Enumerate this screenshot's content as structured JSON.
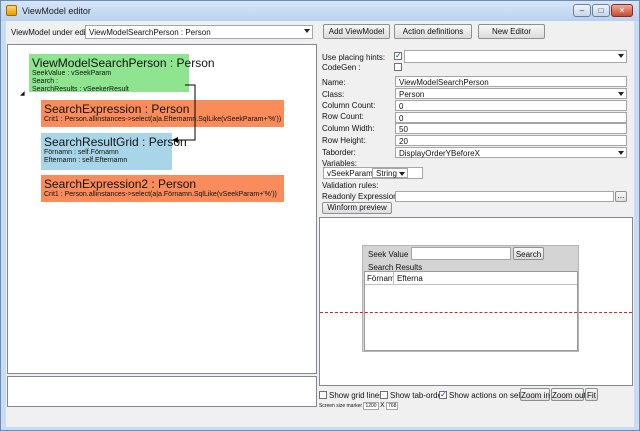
{
  "window": {
    "title": "ViewModel editor"
  },
  "toolbar": {
    "vm_label": "ViewModel under edit:",
    "vm_value": "ViewModelSearchPerson : Person",
    "add_viewmodel": "Add ViewModel",
    "action_definitions": "Action definitions",
    "new_editor": "New Editor"
  },
  "canvas": {
    "nodes": [
      {
        "title": "ViewModelSearchPerson : Person",
        "lines": [
          "SeekValue : vSeekParam",
          "Search :",
          "SearchResults : vSeekerResult"
        ]
      },
      {
        "title": "SearchExpression : Person",
        "lines": [
          "Crit1 : Person.allinstances->select(a|a.Efternamn.SqlLike(vSeekParam+'%'))"
        ]
      },
      {
        "title": "SearchResultGrid : Person",
        "lines": [
          "Förnamn : self.Förnamn",
          "Efternamn : self.Efternamn"
        ]
      },
      {
        "title": "SearchExpression2 : Person",
        "lines": [
          "Crit1 : Person.allinstances->select(a|a.Förnamn.SqlLike(vSeekParam+'%'))"
        ]
      }
    ]
  },
  "props": {
    "placing_hints_label": "Use placing hints:",
    "codegen_label": "CodeGen :",
    "name_label": "Name:",
    "name_value": "ViewModelSearchPerson",
    "class_label": "Class:",
    "class_value": "Person",
    "colcount_label": "Column Count:",
    "colcount_value": "0",
    "rowcount_label": "Row Count:",
    "rowcount_value": "0",
    "colwidth_label": "Column Width:",
    "colwidth_value": "50",
    "rowheight_label": "Row Height:",
    "rowheight_value": "20",
    "taborder_label": "Taborder:",
    "taborder_value": "DisplayOrderYBeforeX",
    "variables_label": "Variables:",
    "var_name": "vSeekParam",
    "var_type": "String",
    "validation_label": "Validation rules:",
    "readonly_label": "Readonly Expression:",
    "readonly_btn": "...",
    "winform_preview": "Winform preview"
  },
  "preview": {
    "seek_label": "Seek Value",
    "search_btn": "Search",
    "results_label": "Search Results",
    "col1": "Förnam",
    "col2": "Efterna"
  },
  "bottom": {
    "show_grid": "Show grid lines",
    "show_tab": "Show tab-order",
    "show_actions": "Show actions on select",
    "zoom_in": "Zoom in",
    "zoom_out": "Zoom out",
    "fit": "Fit",
    "screen_size": "Screen size marker",
    "screen_w": "1200",
    "screen_x": "X",
    "screen_h": "768"
  }
}
